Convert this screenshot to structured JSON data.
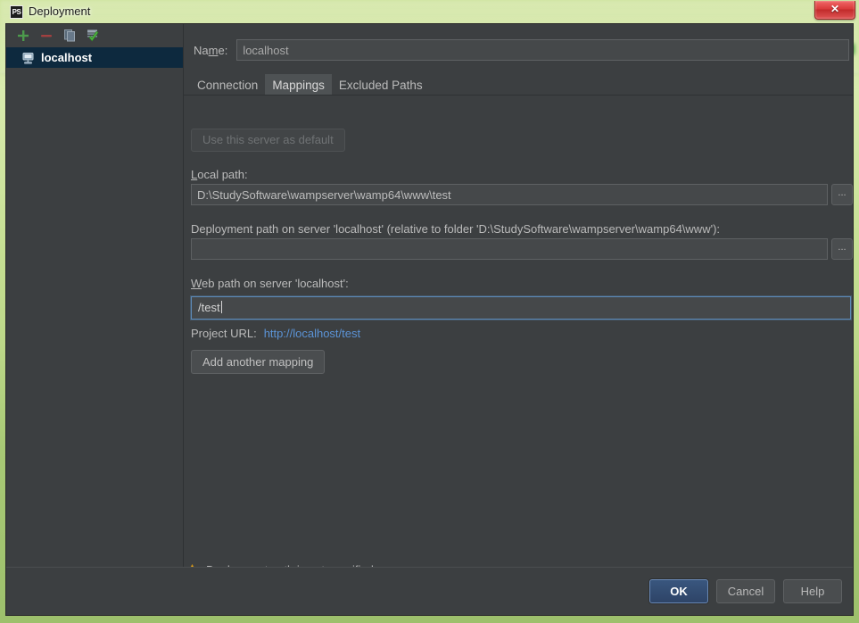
{
  "window": {
    "title": "Deployment",
    "app_icon": "PS",
    "close_label": "✕"
  },
  "sidebar": {
    "toolbar": [
      {
        "name": "add-server-button",
        "icon": "plus-icon",
        "tooltip": "Add"
      },
      {
        "name": "remove-server-button",
        "icon": "minus-icon",
        "tooltip": "Remove"
      },
      {
        "name": "copy-server-button",
        "icon": "copy-icon",
        "tooltip": "Copy"
      },
      {
        "name": "set-default-button",
        "icon": "check-mark-icon",
        "tooltip": "Use as default"
      }
    ],
    "servers": [
      {
        "label": "localhost",
        "icon": "server-icon",
        "selected": true
      }
    ]
  },
  "form": {
    "name_label": "Na",
    "name_label_mnemonic": "m",
    "name_label_rest": "e:",
    "name_value": "localhost"
  },
  "tabs": [
    {
      "id": "connection",
      "label": "Connection",
      "active": false
    },
    {
      "id": "mappings",
      "label": "Mappings",
      "active": true
    },
    {
      "id": "excluded-paths",
      "label": "Excluded Paths",
      "active": false
    }
  ],
  "mappings": {
    "use_default_button": "Use this server as default",
    "use_default_disabled": true,
    "local_path_label_pre": "L",
    "local_path_label_mnemonic": "o",
    "local_path_label_post": "cal path:",
    "local_path_label": "Local path:",
    "local_path_value": "D:\\StudySoftware\\wampserver\\wamp64\\www\\test",
    "deploy_path_label": "Deployment path on server 'localhost' (relative to folder 'D:\\StudySoftware\\wampserver\\wamp64\\www'):",
    "deploy_path_label_pre": "D",
    "deploy_path_label_mnemonic": "e",
    "deploy_path_label_post": "ployment path on server 'localhost' (relative to folder 'D:\\StudySoftware\\wampserver\\wamp64\\www'):",
    "deploy_path_value": "",
    "web_path_label": "Web path on server 'localhost':",
    "web_path_label_mnemonic": "W",
    "web_path_label_post": "eb path on server 'localhost':",
    "web_path_value": "/test",
    "project_url_label": "Project URL:",
    "project_url_value": "http://localhost/test",
    "add_mapping_button": "Add another mapping",
    "browse_button_label": "..."
  },
  "status": {
    "warning_text": "Deployment path is not specified.",
    "warning_icon": "warning-triangle-icon"
  },
  "footer": {
    "ok_label": "OK",
    "cancel_label": "Cancel",
    "help_label": "Help"
  },
  "colors": {
    "accent_link": "#5b93d6",
    "selection": "#0d293e",
    "warning": "#f0b63c",
    "panel_bg": "#3c3f41",
    "focus_border": "#5c8ab8"
  }
}
